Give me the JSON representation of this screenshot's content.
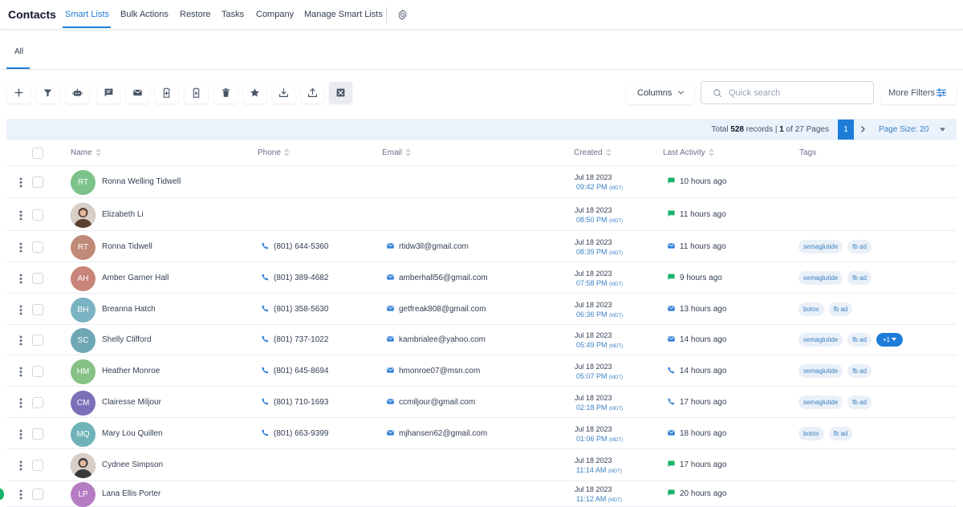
{
  "nav": {
    "app_title": "Contacts",
    "tabs": [
      "Smart Lists",
      "Bulk Actions",
      "Restore",
      "Tasks",
      "Company",
      "Manage Smart Lists"
    ]
  },
  "subtabs": {
    "all": "All"
  },
  "toolbar": {
    "buttons": [
      "add-icon",
      "filter-icon",
      "robot-icon",
      "message-icon",
      "mail-icon",
      "clipboard-add-icon",
      "clipboard-remove-icon",
      "trash-icon",
      "star-icon",
      "download-icon",
      "upload-icon",
      "merge-icon"
    ],
    "columns_label": "Columns",
    "search_placeholder": "Quick search",
    "more_filters_label": "More Filters"
  },
  "pagination": {
    "total_prefix": "Total ",
    "total_records": "528",
    "total_mid": " records | ",
    "current_page": "1",
    "page_of": " of 27 Pages",
    "page_button": "1",
    "page_size_label": "Page Size: 20"
  },
  "table": {
    "headers": {
      "name": "Name",
      "phone": "Phone",
      "email": "Email",
      "created": "Created",
      "last_activity": "Last Activity",
      "tags": "Tags"
    },
    "rows": [
      {
        "initials": "RT",
        "avatar_color": "#7cc28a",
        "name": "Ronna Welling Tidwell",
        "phone": "",
        "email": "",
        "created_date": "Jul 18 2023",
        "created_time": "09:42 PM",
        "tz": "(MDT)",
        "activity_icon": "sms-icon",
        "activity": "10 hours ago",
        "tags": []
      },
      {
        "initials": "",
        "avatar_color": "#5a4030",
        "photo": true,
        "name": "Elizabeth Li",
        "phone": "",
        "email": "",
        "created_date": "Jul 18 2023",
        "created_time": "08:50 PM",
        "tz": "(MDT)",
        "activity_icon": "sms-icon",
        "activity": "11 hours ago",
        "tags": []
      },
      {
        "initials": "RT",
        "avatar_color": "#c08a78",
        "name": "Ronna Tidwell",
        "phone": "(801) 644-5360",
        "email": "rtidw3ll@gmail.com",
        "created_date": "Jul 18 2023",
        "created_time": "08:39 PM",
        "tz": "(MDT)",
        "activity_icon": "email-icon",
        "activity": "11 hours ago",
        "tags": [
          "semaglutide",
          "fb ad"
        ]
      },
      {
        "initials": "AH",
        "avatar_color": "#c98579",
        "name": "Amber Garner Hall",
        "phone": "(801) 389-4682",
        "email": "amberhall56@gmail.com",
        "created_date": "Jul 18 2023",
        "created_time": "07:58 PM",
        "tz": "(MDT)",
        "activity_icon": "sms-icon",
        "activity": "9 hours ago",
        "tags": [
          "semaglutide",
          "fb ad"
        ]
      },
      {
        "initials": "BH",
        "avatar_color": "#7ab3c4",
        "name": "Breanna Hatch",
        "phone": "(801) 358-5630",
        "email": "getfreak808@gmail.com",
        "created_date": "Jul 18 2023",
        "created_time": "06:36 PM",
        "tz": "(MDT)",
        "activity_icon": "email-icon",
        "activity": "13 hours ago",
        "tags": [
          "botox",
          "fb ad"
        ]
      },
      {
        "initials": "SC",
        "avatar_color": "#6fa8b5",
        "name": "Shelly Clifford",
        "phone": "(801) 737-1022",
        "email": "kambrialee@yahoo.com",
        "created_date": "Jul 18 2023",
        "created_time": "05:49 PM",
        "tz": "(MDT)",
        "activity_icon": "email-icon",
        "activity": "14 hours ago",
        "tags": [
          "semaglutide",
          "fb ad"
        ],
        "more_tags": "+1"
      },
      {
        "initials": "HM",
        "avatar_color": "#86c285",
        "name": "Heather Monroe",
        "phone": "(801) 645-8694",
        "email": "hmonroe07@msn.com",
        "created_date": "Jul 18 2023",
        "created_time": "05:07 PM",
        "tz": "(MDT)",
        "activity_icon": "phone-icon",
        "activity": "14 hours ago",
        "tags": [
          "semaglutide",
          "fb ad"
        ]
      },
      {
        "initials": "CM",
        "avatar_color": "#7b6fb8",
        "name": "Clairesse Miljour",
        "phone": "(801) 710-1693",
        "email": "ccmiljour@gmail.com",
        "created_date": "Jul 18 2023",
        "created_time": "02:18 PM",
        "tz": "(MDT)",
        "activity_icon": "phone-icon",
        "activity": "17 hours ago",
        "tags": [
          "semaglutide",
          "fb ad"
        ]
      },
      {
        "initials": "MQ",
        "avatar_color": "#6fb3b8",
        "name": "Mary Lou Quillen",
        "phone": "(801) 663-9399",
        "email": "mjhansen62@gmail.com",
        "created_date": "Jul 18 2023",
        "created_time": "01:06 PM",
        "tz": "(MDT)",
        "activity_icon": "email-icon",
        "activity": "18 hours ago",
        "tags": [
          "botox",
          "fb ad"
        ]
      },
      {
        "initials": "",
        "avatar_color": "#3a3a3a",
        "photo": true,
        "name": "Cydnee Simpson",
        "phone": "",
        "email": "",
        "created_date": "Jul 18 2023",
        "created_time": "11:14 AM",
        "tz": "(MDT)",
        "activity_icon": "sms-icon",
        "activity": "17 hours ago",
        "tags": []
      },
      {
        "initials": "LP",
        "avatar_color": "#b67cc3",
        "name": "Lana Ellis Porter",
        "phone": "",
        "email": "",
        "created_date": "Jul 18 2023",
        "created_time": "11:12 AM",
        "tz": "(MDT)",
        "activity_icon": "sms-icon",
        "activity": "20 hours ago",
        "tags": []
      }
    ]
  },
  "colors": {
    "accent": "#1e7dd8",
    "sms_green": "#17b26a",
    "email_blue": "#2e7fd6"
  }
}
